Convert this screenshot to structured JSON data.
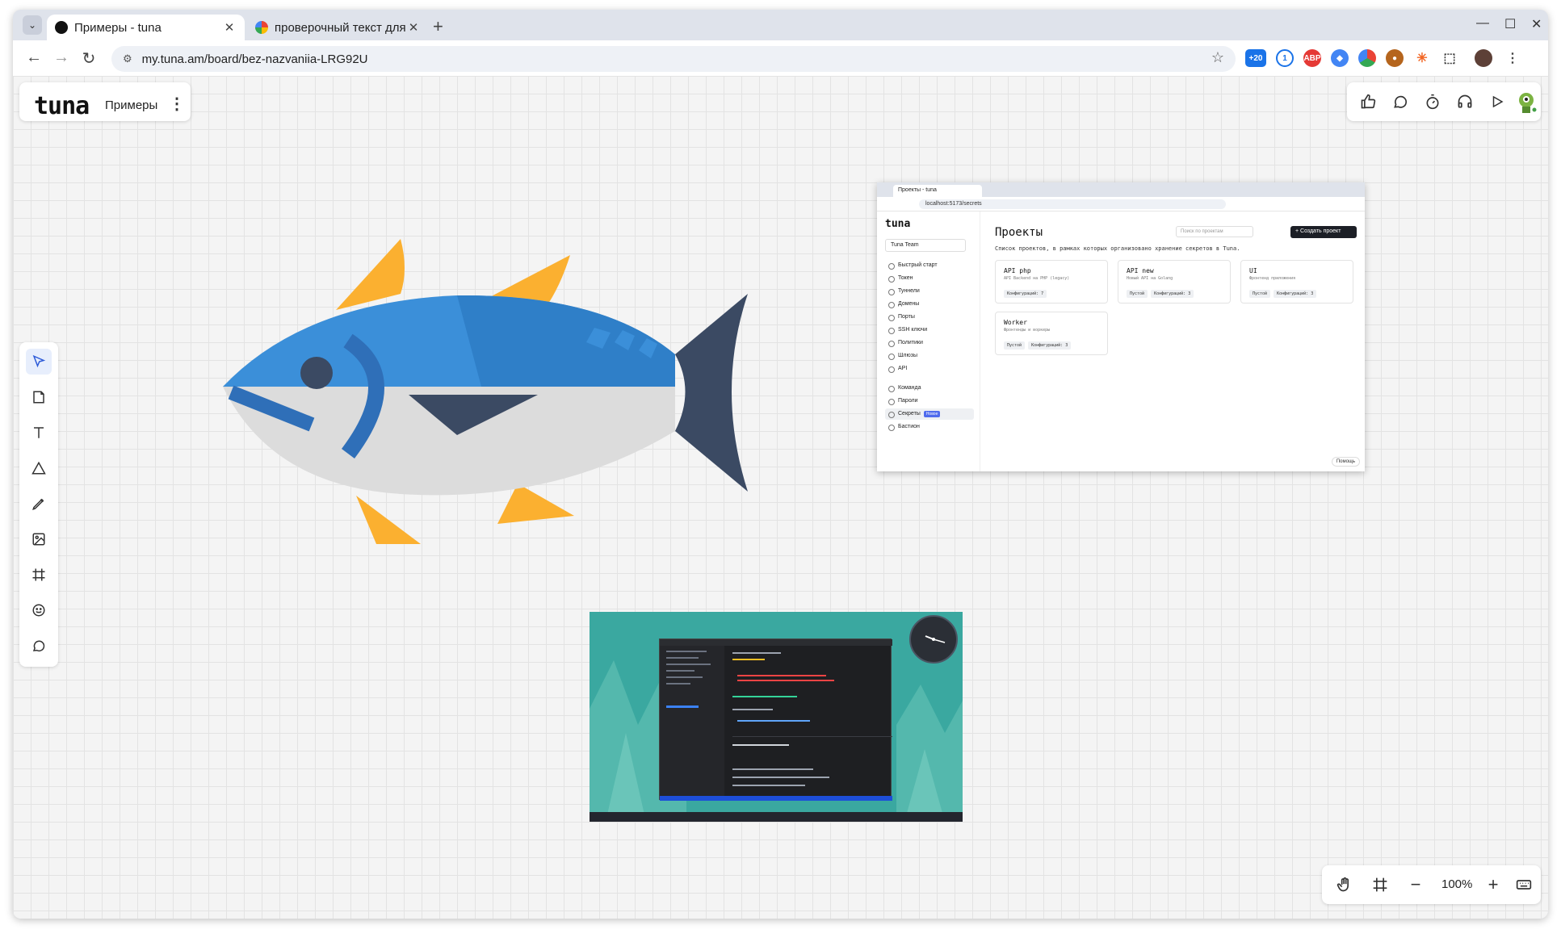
{
  "browser": {
    "tabs": [
      {
        "title": "Примеры - tuna",
        "active": true
      },
      {
        "title": "проверочный текст для ш",
        "active": false
      }
    ],
    "url": "my.tuna.am/board/bez-nazvaniia-LRG92U",
    "extension_badge": "+20"
  },
  "board": {
    "logo": "tuna",
    "name": "Примеры",
    "zoom": "100%"
  },
  "left_tools": [
    "select-icon",
    "sticky-note-icon",
    "text-icon",
    "shape-icon",
    "pen-icon",
    "image-icon",
    "frame-icon",
    "emoji-icon",
    "comment-icon"
  ],
  "top_right_tools": [
    "like-icon",
    "chat-icon",
    "timer-icon",
    "headphones-icon",
    "play-icon",
    "avatar"
  ],
  "embedded_screenshot_1": {
    "tab_title": "Проекты - tuna",
    "url": "localhost:5173/secrets",
    "logo": "tuna",
    "team": "Tuna Team",
    "nav": [
      "Быстрый старт",
      "Токен",
      "Туннели",
      "Домены",
      "Порты",
      "SSH ключи",
      "Политики",
      "Шлюзы",
      "API",
      "Команда",
      "Пароли",
      "Секреты",
      "Бастион"
    ],
    "nav_badge": "Новое",
    "heading": "Проекты",
    "subtitle": "Список проектов, в рамках которых организовано хранение секретов в Tuna.",
    "search_placeholder": "Поиск по проектам",
    "create_button": "+ Создать проект",
    "cards": [
      {
        "title": "API php",
        "desc": "API Backend на PHP (legacy)",
        "tags": [
          "Конфигураций: 7"
        ]
      },
      {
        "title": "API new",
        "desc": "Новый API на Golang",
        "tags": [
          "Пустой",
          "Конфигураций: 3"
        ]
      },
      {
        "title": "UI",
        "desc": "Фронтенд приложения",
        "tags": [
          "Пустой",
          "Конфигураций: 3"
        ]
      },
      {
        "title": "Worker",
        "desc": "Фронтенды и воркеры",
        "tags": [
          "Пустой",
          "Конфигураций: 3"
        ]
      }
    ],
    "help": "Помощь"
  },
  "colors": {
    "accent": "#4f6bed",
    "fish_blue": "#3b8fd9",
    "fish_dark": "#3b4a63",
    "fish_fin": "#fbb030",
    "fish_belly": "#dcdcdc"
  }
}
